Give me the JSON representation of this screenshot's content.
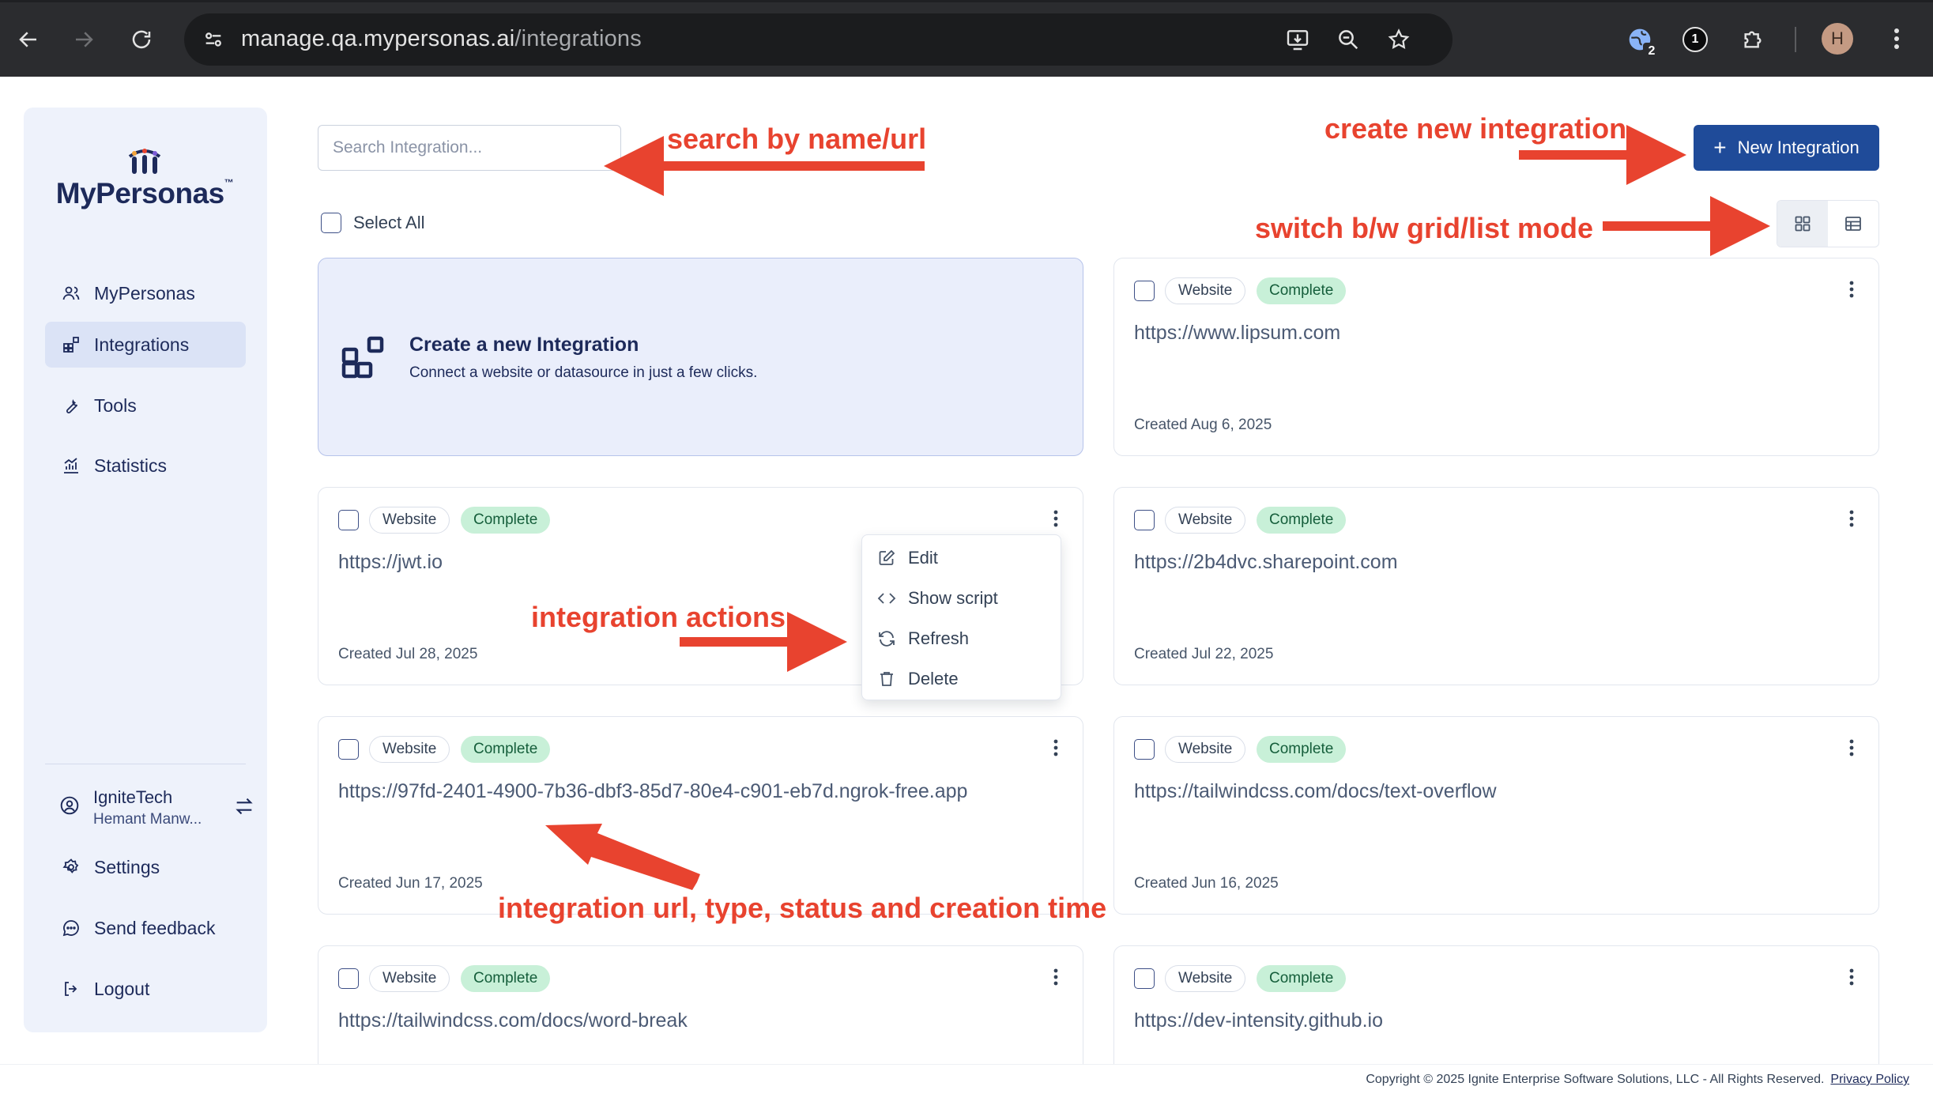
{
  "browser": {
    "url_host": "manage.qa.mypersonas.ai",
    "url_path": "/integrations",
    "extension_badge_1": "2",
    "extension_badge_2": "1",
    "profile_initial": "H"
  },
  "sidebar": {
    "logo_text": "MyPersonas",
    "logo_tm": "™",
    "items": [
      {
        "label": "MyPersonas",
        "icon": "users-icon"
      },
      {
        "label": "Integrations",
        "icon": "grid-plus-icon",
        "active": true
      },
      {
        "label": "Tools",
        "icon": "wrench-icon"
      },
      {
        "label": "Statistics",
        "icon": "chart-icon"
      }
    ],
    "org": {
      "name": "IgniteTech",
      "user": "Hemant Manw..."
    },
    "bottom_items": [
      {
        "label": "Settings",
        "icon": "gear-icon"
      },
      {
        "label": "Send feedback",
        "icon": "feedback-icon"
      },
      {
        "label": "Logout",
        "icon": "logout-icon"
      }
    ]
  },
  "toolbar": {
    "search_placeholder": "Search Integration...",
    "new_button_label": "New Integration",
    "select_all_label": "Select All"
  },
  "create_card": {
    "title": "Create a new Integration",
    "subtitle": "Connect a website or datasource in just a few clicks."
  },
  "integrations": [
    {
      "type": "Website",
      "status": "Complete",
      "url": "https://www.lipsum.com",
      "created": "Created Aug 6, 2025"
    },
    {
      "type": "Website",
      "status": "Complete",
      "url": "https://jwt.io",
      "created": "Created Jul 28, 2025"
    },
    {
      "type": "Website",
      "status": "Complete",
      "url": "https://2b4dvc.sharepoint.com",
      "created": "Created Jul 22, 2025"
    },
    {
      "type": "Website",
      "status": "Complete",
      "url": "https://97fd-2401-4900-7b36-dbf3-85d7-80e4-c901-eb7d.ngrok-free.app",
      "created": "Created Jun 17, 2025"
    },
    {
      "type": "Website",
      "status": "Complete",
      "url": "https://tailwindcss.com/docs/text-overflow",
      "created": "Created Jun 16, 2025"
    },
    {
      "type": "Website",
      "status": "Complete",
      "url": "https://tailwindcss.com/docs/word-break",
      "created": ""
    },
    {
      "type": "Website",
      "status": "Complete",
      "url": "https://dev-intensity.github.io",
      "created": ""
    }
  ],
  "action_menu": {
    "items": [
      {
        "label": "Edit",
        "icon": "edit-icon"
      },
      {
        "label": "Show script",
        "icon": "code-icon"
      },
      {
        "label": "Refresh",
        "icon": "refresh-icon"
      },
      {
        "label": "Delete",
        "icon": "trash-icon"
      }
    ]
  },
  "footer": {
    "copyright": "Copyright © 2025 Ignite Enterprise Software Solutions, LLC - All Rights Reserved.",
    "privacy_link": "Privacy Policy"
  },
  "annotations": {
    "search": "search by name/url",
    "create": "create new integration",
    "switch": "switch b/w grid/list mode",
    "actions": "integration actions",
    "details": "integration url, type, status and creation time"
  },
  "colors": {
    "primary": "#1f4b99",
    "sidebar_bg": "#eef2fb",
    "status_bg": "#c8f0d8",
    "annotation": "#e8432f"
  }
}
